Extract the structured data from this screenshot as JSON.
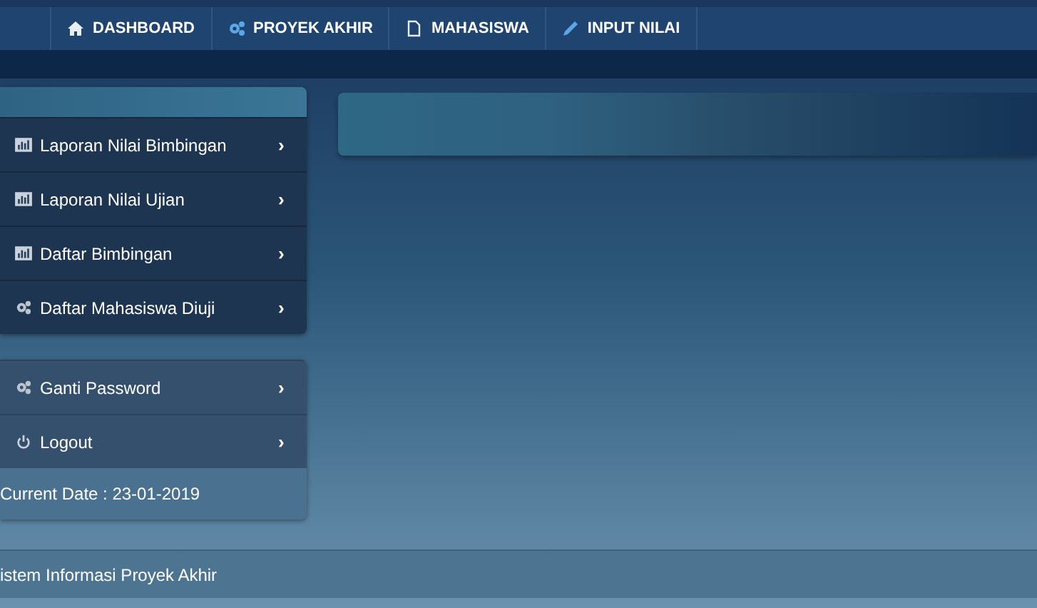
{
  "nav": [
    {
      "label": "DASHBOARD",
      "kind": "house"
    },
    {
      "label": "PROYEK AKHIR",
      "kind": "gears"
    },
    {
      "label": "MAHASISWA",
      "kind": "document"
    },
    {
      "label": "INPUT NILAI",
      "kind": "pencil"
    }
  ],
  "sidebar": {
    "menu": [
      {
        "label": "Laporan Nilai Bimbingan",
        "kind": "chart",
        "arrow": "›"
      },
      {
        "label": "Laporan Nilai Ujian",
        "kind": "chart",
        "arrow": "›"
      },
      {
        "label": "Daftar Bimbingan",
        "kind": "chart",
        "arrow": "›"
      },
      {
        "label": "Daftar Mahasiswa Diuji",
        "kind": "gears",
        "arrow": "›"
      }
    ],
    "account": [
      {
        "label": "Ganti Password",
        "kind": "gears",
        "arrow": "›"
      },
      {
        "label": "Logout",
        "kind": "power",
        "arrow": "›"
      }
    ],
    "current_date": "Current Date : 23-01-2019"
  },
  "footer": "istem Informasi Proyek Akhir"
}
